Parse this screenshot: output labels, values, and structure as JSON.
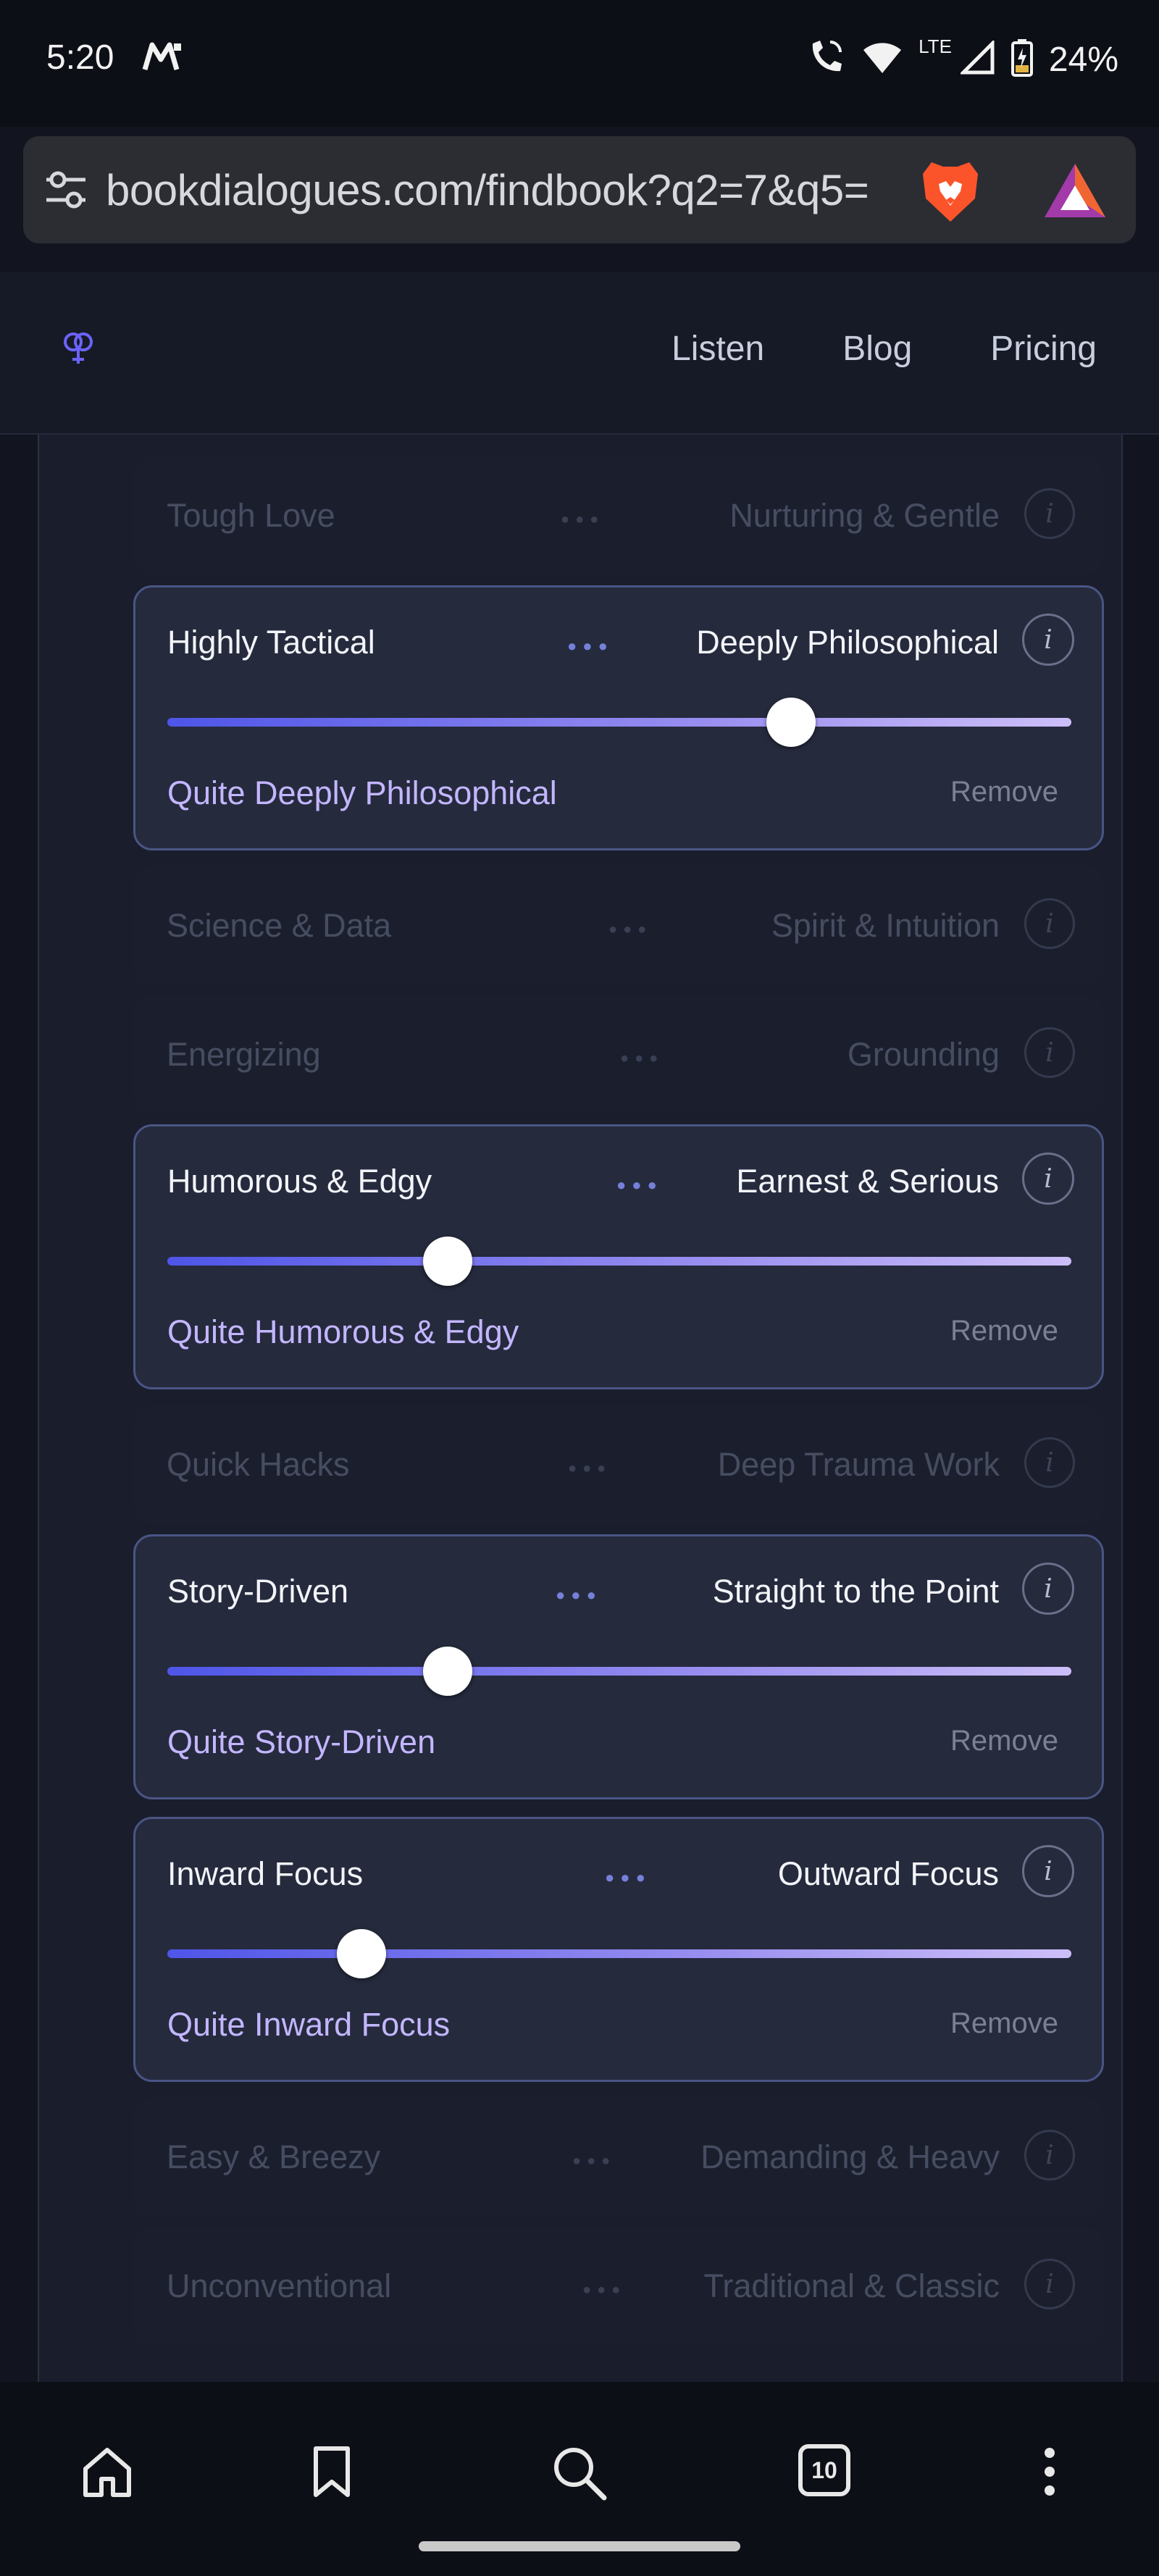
{
  "status_bar": {
    "time": "5:20",
    "network": "LTE",
    "battery": "24%"
  },
  "browser": {
    "url": "bookdialogues.com/findbook?q2=7&q5=",
    "tab_count": "10",
    "icons": [
      "tune-icon",
      "brave-lion-icon",
      "brave-rewards-icon",
      "home-icon",
      "bookmark-icon",
      "search-icon",
      "tabs-icon",
      "more-vertical-icon"
    ]
  },
  "nav": {
    "listen": "Listen",
    "blog": "Blog",
    "pricing": "Pricing"
  },
  "info_glyph": "i",
  "remove_label": "Remove",
  "rows": [
    {
      "left": "Tough Love",
      "right": "Nurturing & Gentle"
    },
    {
      "left": "Science & Data",
      "right": "Spirit & Intuition"
    },
    {
      "left": "Energizing",
      "right": "Grounding"
    },
    {
      "left": "Quick Hacks",
      "right": "Deep Trauma Work"
    },
    {
      "left": "Easy & Breezy",
      "right": "Demanding & Heavy"
    },
    {
      "left": "Unconventional",
      "right": "Traditional & Classic"
    }
  ],
  "cards": [
    {
      "left": "Highly Tactical",
      "right": "Deeply Philosophical",
      "value": "Quite Deeply Philosophical",
      "level": 0.69
    },
    {
      "left": "Humorous & Edgy",
      "right": "Earnest & Serious",
      "value": "Quite Humorous & Edgy",
      "level": 0.31
    },
    {
      "left": "Story-Driven",
      "right": "Straight to the Point",
      "value": "Quite Story-Driven",
      "level": 0.31
    },
    {
      "left": "Inward Focus",
      "right": "Outward Focus",
      "value": "Quite Inward Focus",
      "level": 0.215
    }
  ],
  "colors": {
    "accent": "#4e55e8",
    "accent_light": "#cdbff8",
    "value_text": "#c3b6ff"
  }
}
